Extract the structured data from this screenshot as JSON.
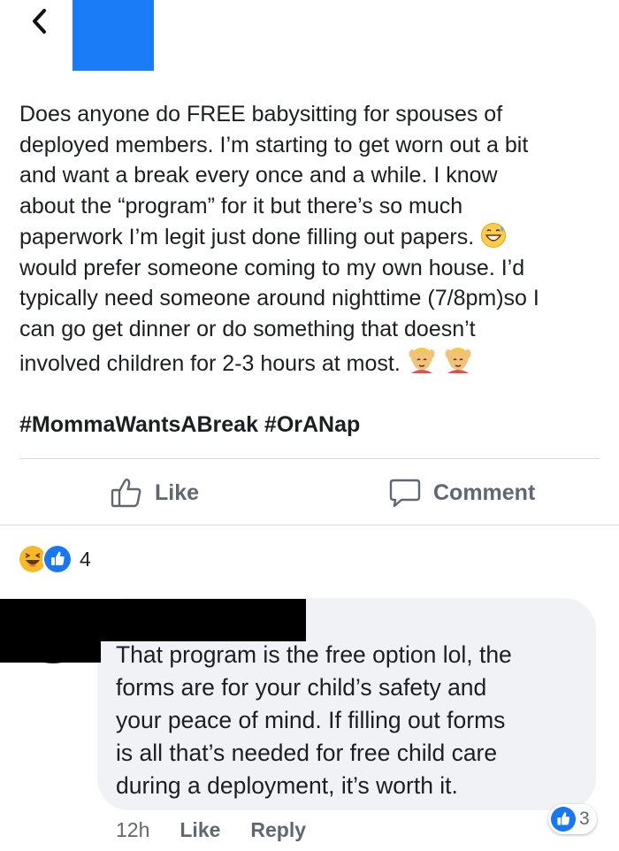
{
  "header": {
    "back_icon": "chevron-left-icon",
    "redaction_color": "#1b7cf7"
  },
  "post": {
    "text_lines": [
      "Does anyone do FREE babysitting for spouses of",
      "deployed members. I’m starting to get worn out a bit",
      "and want a break every once and a while. I know",
      "about the “program” for it but there’s so much",
      "paperwork I’m legit just done filling out papers.",
      "would prefer someone coming to my own house. I’d",
      "typically need someone around nighttime (7/8pm)so I",
      "can go get dinner or do something that doesn’t",
      "involved children for 2-3 hours at most."
    ],
    "emoji_after_line_5": "grinning-sweat-emoji",
    "emoji_after_line_9": [
      "woman-getting-massage-emoji",
      "woman-getting-massage-emoji"
    ],
    "hashtags": "#MommaWantsABreak #OrANap"
  },
  "actions": {
    "like_label": "Like",
    "like_icon": "thumbs-up-outline-icon",
    "comment_label": "Comment",
    "comment_icon": "speech-bubble-icon"
  },
  "reactions": {
    "types": [
      "haha",
      "like"
    ],
    "count": "4"
  },
  "comment": {
    "text_lines": [
      "That program is the free option lol, the",
      "forms are for your child’s safety and",
      "your peace of mind.  If filling out forms",
      "is all that’s needed for free child care",
      "during a deployment, it’s worth it."
    ],
    "time": "12h",
    "like_label": "Like",
    "reply_label": "Reply",
    "reaction_count": "3"
  },
  "colors": {
    "text": "#1c1e21",
    "secondary": "#606770",
    "like_blue": "#1877f2",
    "haha_yellow": "#f7b928",
    "bubble": "#f0f2f5"
  }
}
